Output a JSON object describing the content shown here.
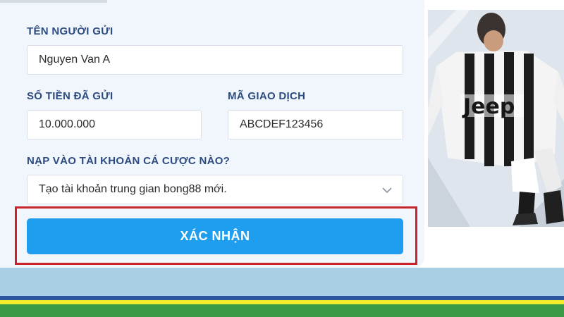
{
  "form": {
    "sender_name": {
      "label": "TÊN NGƯỜI GỬI",
      "value": "Nguyen Van A"
    },
    "amount": {
      "label": "SỐ TIỀN ĐÃ GỬI",
      "value": "10.000.000"
    },
    "transaction_code": {
      "label": "MÃ GIAO DỊCH",
      "value": "ABCDEF123456"
    },
    "account": {
      "label": "NẠP VÀO TÀI KHOẢN CÁ CƯỢC NÀO?",
      "selected": "Tạo tài khoản trung gian bong88 mới."
    },
    "submit_label": "XÁC NHẬN"
  },
  "promo": {
    "jersey_text": "Jeep"
  },
  "colors": {
    "label": "#2c4b80",
    "button": "#1f9ef0",
    "highlight": "#c9232c",
    "card_bg": "#f1f6fd"
  },
  "icons": {
    "select_arrow": "chevron-down-icon"
  }
}
